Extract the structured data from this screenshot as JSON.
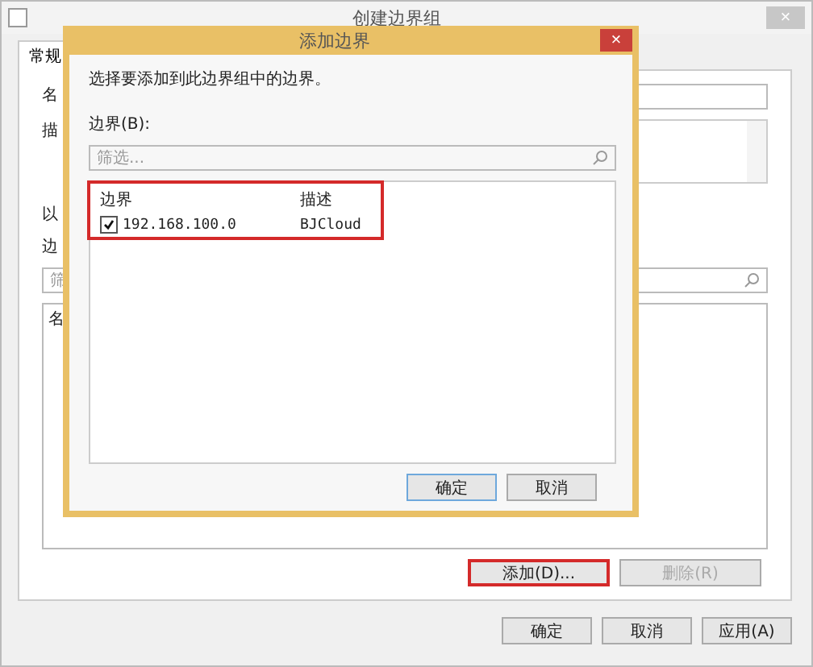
{
  "window": {
    "title": "创建边界组",
    "close": "×"
  },
  "tabs": [
    {
      "label": "常规",
      "selected": true
    }
  ],
  "general": {
    "name_label": "名",
    "description_label": "描",
    "hint": "以",
    "boundaries_label": "边",
    "filter_placeholder": "筛",
    "list_header": "名"
  },
  "main_buttons": [
    {
      "label": "添加(D)...",
      "disabled": false,
      "highlighted": true
    },
    {
      "label": "删除(R)",
      "disabled": true,
      "highlighted": false
    }
  ],
  "footer_buttons": [
    {
      "label": "确定"
    },
    {
      "label": "取消"
    },
    {
      "label": "应用(A)"
    }
  ],
  "dialog": {
    "title": "添加边界",
    "close": "×",
    "instruction": "选择要添加到此边界组中的边界。",
    "list_label": "边界(B):",
    "filter_placeholder": "筛选...",
    "columns": [
      "边界",
      "描述"
    ],
    "rows": [
      {
        "checked": true,
        "cells": [
          "192.168.100.0",
          "BJCloud"
        ]
      }
    ],
    "buttons": [
      {
        "label": "确定",
        "default": true
      },
      {
        "label": "取消",
        "default": false
      }
    ]
  }
}
